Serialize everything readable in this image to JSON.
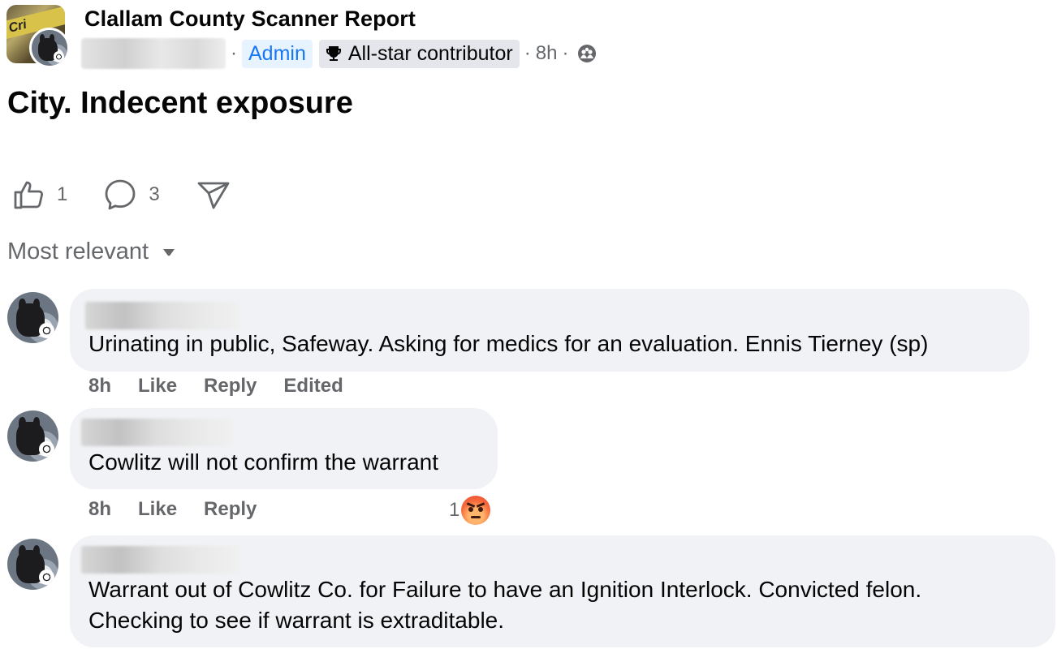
{
  "post": {
    "group_name": "Clallam County Scanner Report",
    "group_avatar_text": "Cri",
    "badges": {
      "admin": "Admin",
      "contributor": "All-star contributor"
    },
    "separator": "·",
    "time": "8h",
    "privacy_icon": "group-members-icon",
    "title": "City. Indecent exposure"
  },
  "actions": {
    "like_count": "1",
    "comment_count": "3"
  },
  "sort": {
    "label": "Most relevant"
  },
  "comments": [
    {
      "text": "Urinating in public, Safeway. Asking for medics for an evaluation. Ennis Tierney (sp)",
      "time": "8h",
      "like": "Like",
      "reply": "Reply",
      "edited": "Edited"
    },
    {
      "text": "Cowlitz will not confirm the warrant",
      "time": "8h",
      "like": "Like",
      "reply": "Reply",
      "reaction_count": "1",
      "reaction_icon": "angry-reaction-icon"
    },
    {
      "line1": "Warrant out of Cowlitz Co. for Failure to have an Ignition Interlock. Convicted felon.",
      "line2": "Checking to see if warrant is extraditable."
    }
  ],
  "colors": {
    "admin_badge_text": "#1877f2",
    "admin_badge_bg": "#e7f3ff",
    "bubble_bg": "#f0f2f5",
    "secondary_text": "#65676b"
  }
}
